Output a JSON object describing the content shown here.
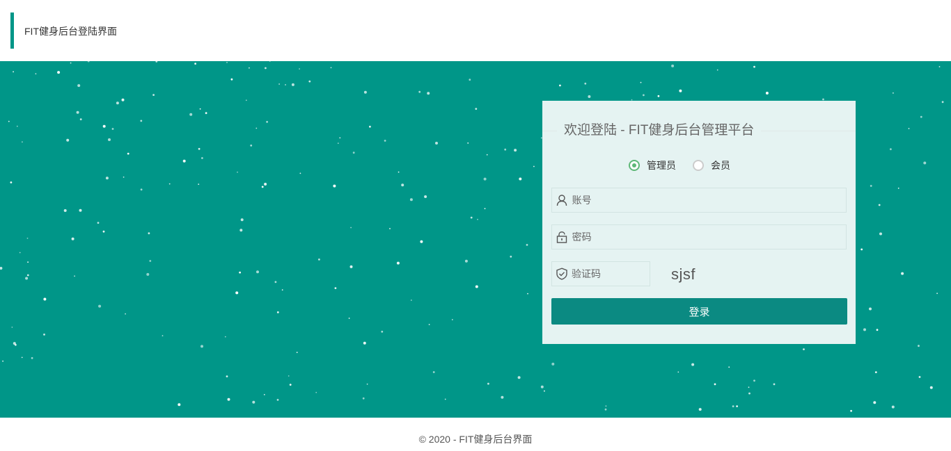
{
  "header": {
    "title": "FIT健身后台登陆界面"
  },
  "login": {
    "heading": "欢迎登陆 - FIT健身后台管理平台",
    "roles": [
      {
        "label": "管理员",
        "checked": true
      },
      {
        "label": "会员",
        "checked": false
      }
    ],
    "account": {
      "placeholder": "账号",
      "value": ""
    },
    "password": {
      "placeholder": "密码",
      "value": ""
    },
    "captcha_input": {
      "placeholder": "验证码",
      "value": ""
    },
    "captcha_text": "sjsf",
    "submit_label": "登录"
  },
  "footer": {
    "text": "© 2020 - FIT健身后台界面"
  },
  "icons": {
    "account": "user-icon",
    "password": "lock-icon",
    "captcha": "shield-icon"
  },
  "colors": {
    "primary": "#009688",
    "button": "#0b8a82",
    "panel": "#e5f3f2",
    "radio_checked": "#5fb878"
  }
}
